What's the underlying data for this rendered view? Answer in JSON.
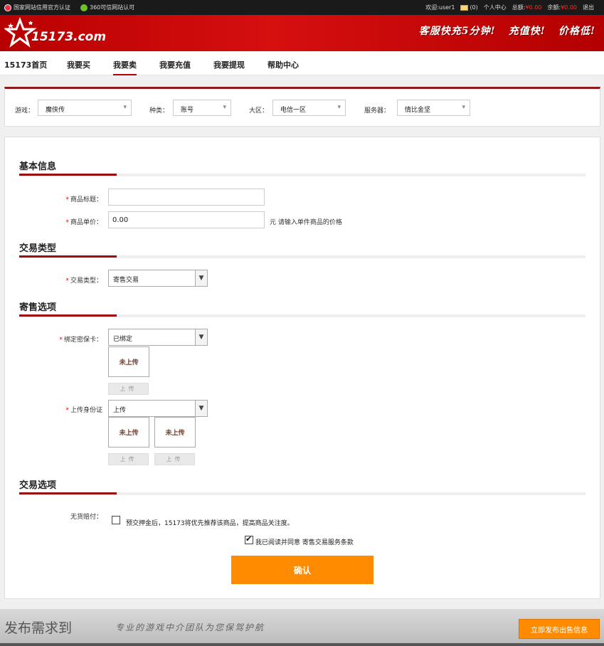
{
  "topbar": {
    "cert1": "国家网站信用官方认证",
    "cert2": "360可信网站认可",
    "welcome": "欢迎:user1",
    "mail_count": "(0)",
    "user_center": "个人中心",
    "total_label": "总额:",
    "total_value": "¥0.00",
    "balance_label": "余额:",
    "balance_value": "¥0.00",
    "logout": "退出"
  },
  "header": {
    "logo_text": "15173.com",
    "slogan": [
      "客服快充5分钟!",
      "充值快!",
      "价格低!"
    ]
  },
  "nav": {
    "items": [
      "15173首页",
      "我要买",
      "我要卖",
      "我要充值",
      "我要提现",
      "帮助中心"
    ]
  },
  "filter": {
    "game_label": "游戏：",
    "game_value": "魔侠传",
    "type_label": "种类：",
    "type_value": "账号",
    "region_label": "大区：",
    "region_value": "电信一区",
    "server_label": "服务器：",
    "server_value": "情比金坚"
  },
  "form": {
    "basic_title": "基本信息",
    "title_label": "商品标题：",
    "title_value": "",
    "price_label": "商品单价：",
    "price_value": "0.00",
    "price_hint": "元 请输入单件商品的价格",
    "trade_type_title": "交易类型",
    "trade_type_label": "交易类型：",
    "trade_type_value": "寄售交易",
    "consign_title": "寄售选项",
    "bind_card_label": "绑定密保卡：",
    "bind_card_value": "已绑定",
    "not_uploaded": "未上传",
    "upload_btn": "上传",
    "id_label": "上传身份证",
    "id_value": "上传",
    "trade_options_title": "交易选项",
    "compensation_label": "无货赔付：",
    "compensation_text": "预交押金后，15173将优先推荐该商品，提高商品关注度。",
    "agree_text": "我已阅读并同意 寄售交易服务条款",
    "confirm": "确认"
  },
  "banner": {
    "big_text": "发布需求到",
    "script_text": "专业的游戏中介团队为您保驾护航",
    "publish_btn": "立即发布出售信息"
  },
  "colors": {
    "brand_red": "#b30000",
    "accent_orange": "#ff8c00"
  }
}
